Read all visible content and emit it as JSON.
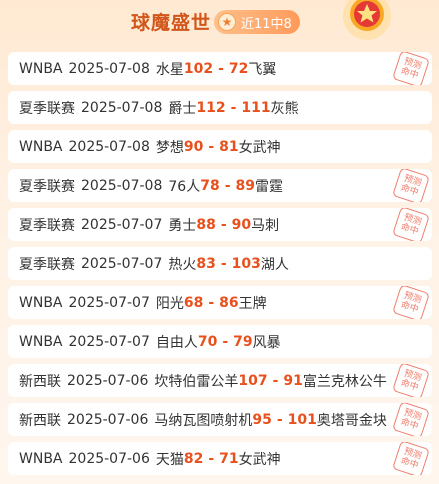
{
  "header": {
    "title": "球魔盛世",
    "record_badge": "近11中8"
  },
  "stamp_text": [
    "预测",
    "命中"
  ],
  "matches": [
    {
      "league": "WNBA",
      "date": "2025-07-08",
      "home": "水星",
      "home_score": "102",
      "away_score": "72",
      "away": "飞翼",
      "hit": true
    },
    {
      "league": "夏季联赛",
      "date": "2025-07-08",
      "home": "爵士",
      "home_score": "112",
      "away_score": "111",
      "away": "灰熊",
      "hit": false
    },
    {
      "league": "WNBA",
      "date": "2025-07-08",
      "home": "梦想",
      "home_score": "90",
      "away_score": "81",
      "away": "女武神",
      "hit": false
    },
    {
      "league": "夏季联赛",
      "date": "2025-07-08",
      "home": "76人",
      "home_score": "78",
      "away_score": "89",
      "away": "雷霆",
      "hit": true
    },
    {
      "league": "夏季联赛",
      "date": "2025-07-07",
      "home": "勇士",
      "home_score": "88",
      "away_score": "90",
      "away": "马刺",
      "hit": true
    },
    {
      "league": "夏季联赛",
      "date": "2025-07-07",
      "home": "热火",
      "home_score": "83",
      "away_score": "103",
      "away": "湖人",
      "hit": false
    },
    {
      "league": "WNBA",
      "date": "2025-07-07",
      "home": "阳光",
      "home_score": "68",
      "away_score": "86",
      "away": "王牌",
      "hit": true
    },
    {
      "league": "WNBA",
      "date": "2025-07-07",
      "home": "自由人",
      "home_score": "70",
      "away_score": "79",
      "away": "风暴",
      "hit": false
    },
    {
      "league": "新西联",
      "date": "2025-07-06",
      "home": "坎特伯雷公羊",
      "home_score": "107",
      "away_score": "91",
      "away": "富兰克林公牛",
      "hit": true
    },
    {
      "league": "新西联",
      "date": "2025-07-06",
      "home": "马纳瓦图喷射机",
      "home_score": "95",
      "away_score": "101",
      "away": "奥塔哥金块",
      "hit": true
    },
    {
      "league": "WNBA",
      "date": "2025-07-06",
      "home": "天猫",
      "home_score": "82",
      "away_score": "71",
      "away": "女武神",
      "hit": true
    }
  ]
}
